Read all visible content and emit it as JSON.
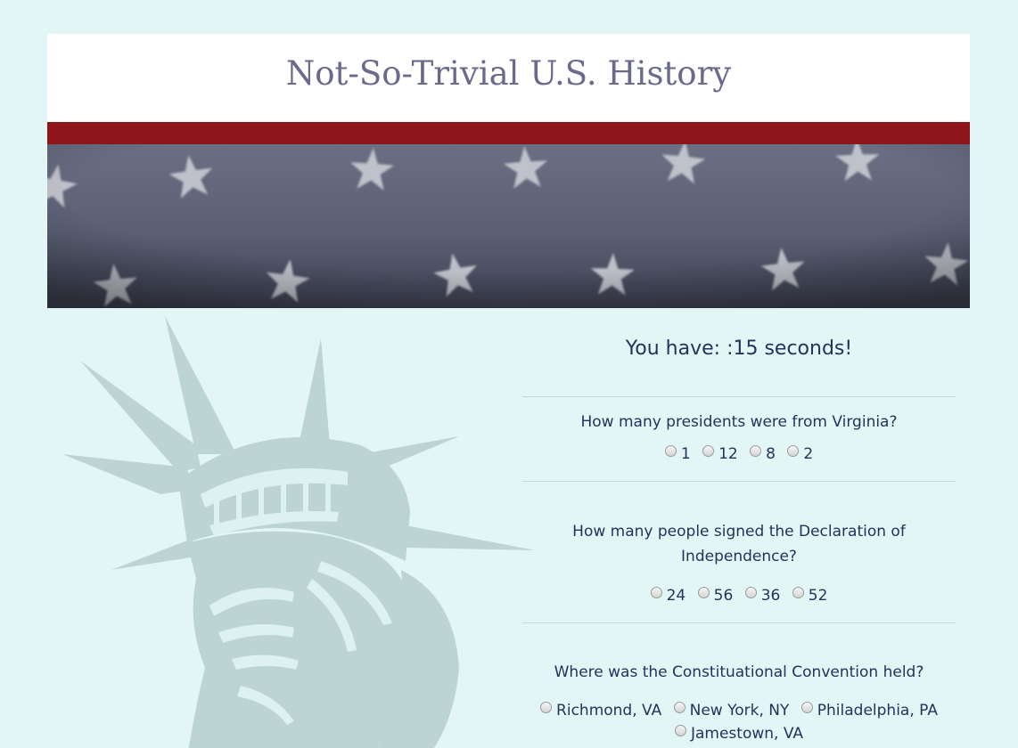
{
  "header": {
    "title": "Not-So-Trivial U.S. History"
  },
  "timer": {
    "text": "You have: :15 seconds!"
  },
  "questions": [
    {
      "text": "How many presidents were from Virginia?",
      "options": [
        "1",
        "12",
        "8",
        "2"
      ]
    },
    {
      "text": "How many people signed the Declaration of Independence?",
      "options": [
        "24",
        "56",
        "36",
        "52"
      ]
    },
    {
      "text": "Where was the Constituational Convention held?",
      "options": [
        "Richmond, VA",
        "New York, NY",
        "Philadelphia, PA",
        "Jamestown, VA"
      ]
    }
  ],
  "colors": {
    "background": "#e2f6f5",
    "title": "#6a6a8c",
    "stripe": "#8e1519",
    "banner": "#585d72",
    "text": "#25325e",
    "liberty": "#bcd5d4"
  },
  "icons": {
    "banner": "star-field",
    "decoration": "statue-of-liberty"
  }
}
